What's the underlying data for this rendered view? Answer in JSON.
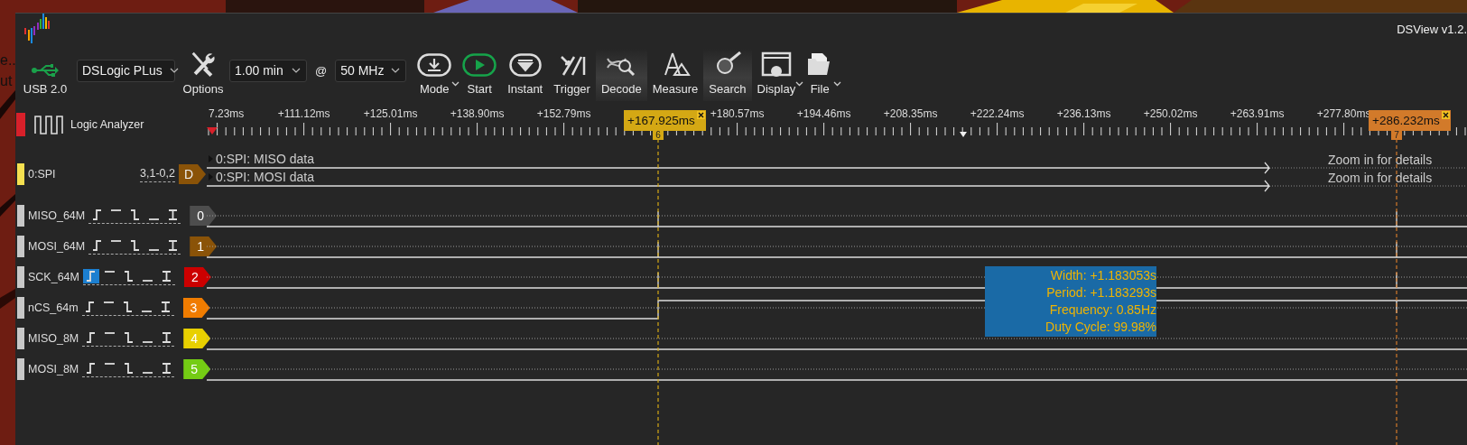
{
  "desktop": {
    "texts": [
      "e..",
      "ut"
    ]
  },
  "window": {
    "title": "DSView v1.2."
  },
  "toolbar": {
    "device": {
      "label": "USB 2.0"
    },
    "device_select": {
      "value": "DSLogic PLus"
    },
    "options": {
      "label": "Options"
    },
    "duration": {
      "value": "1.00 min"
    },
    "at": "@",
    "rate": {
      "value": "50 MHz"
    },
    "tools": [
      {
        "label": "Mode",
        "active": false,
        "menu": true
      },
      {
        "label": "Start",
        "active": false,
        "menu": false
      },
      {
        "label": "Instant",
        "active": false,
        "menu": false
      },
      {
        "label": "Trigger",
        "active": false,
        "menu": false
      },
      {
        "label": "Decode",
        "active": true,
        "menu": false
      },
      {
        "label": "Measure",
        "active": false,
        "menu": false
      },
      {
        "label": "Search",
        "active": true,
        "menu": false
      },
      {
        "label": "Display",
        "active": false,
        "menu": true
      },
      {
        "label": "File",
        "active": false,
        "menu": true
      }
    ]
  },
  "ruler": {
    "title": "Logic Analyzer",
    "labels": [
      "7.23ms",
      "+111.12ms",
      "+125.01ms",
      "+138.90ms",
      "+152.79ms",
      "+180.57ms",
      "+194.46ms",
      "+208.35ms",
      "+222.24ms",
      "+236.13ms",
      "+250.02ms",
      "+263.91ms",
      "+277.80ms"
    ]
  },
  "cursors": [
    {
      "label": "+167.925ms",
      "number": "6",
      "color": "#d4a814"
    },
    {
      "label": "+286.232ms",
      "number": "7",
      "color": "#d27a2a"
    }
  ],
  "decoder": {
    "name": "0:SPI",
    "range": "3,1-0,2",
    "badge": "D",
    "color": "#8a5308",
    "rows": [
      {
        "text": "0:SPI: MISO data",
        "note": "Zoom in for details"
      },
      {
        "text": "0:SPI: MOSI data",
        "note": "Zoom in for details"
      }
    ]
  },
  "channels": [
    {
      "name": "MISO_64M",
      "index": "0",
      "color": "#4d4d4d",
      "rising_trigger": false,
      "kind": "pulses"
    },
    {
      "name": "MOSI_64M",
      "index": "1",
      "color": "#8a5308",
      "rising_trigger": false,
      "kind": "pulses"
    },
    {
      "name": "SCK_64M",
      "index": "2",
      "color": "#cc0000",
      "rising_trigger": true,
      "kind": "pulses"
    },
    {
      "name": "nCS_64m",
      "index": "3",
      "color": "#f07c00",
      "rising_trigger": false,
      "kind": "step"
    },
    {
      "name": "MISO_8M",
      "index": "4",
      "color": "#e8d000",
      "rising_trigger": false,
      "kind": "flat"
    },
    {
      "name": "MOSI_8M",
      "index": "5",
      "color": "#74cc14",
      "rising_trigger": false,
      "kind": "flat"
    }
  ],
  "measurement": {
    "lines": [
      "Width: +1.183053s",
      "Period: +1.183293s",
      "Frequency: 0.85Hz",
      "Duty Cycle: 99.98%"
    ]
  }
}
